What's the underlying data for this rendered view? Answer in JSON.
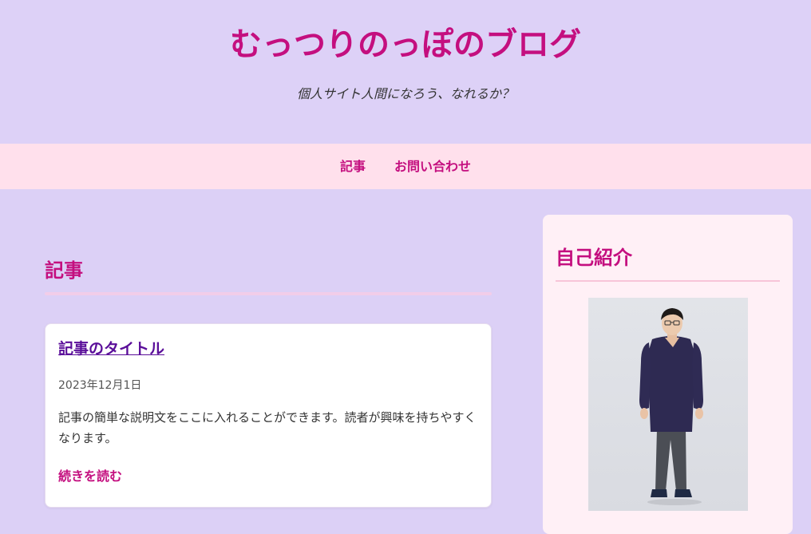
{
  "header": {
    "title": "むっつりのっぽのブログ",
    "tagline": "個人サイト人間になろう、なれるか？"
  },
  "nav": {
    "items": [
      {
        "label": "記事"
      },
      {
        "label": "お問い合わせ"
      }
    ]
  },
  "main": {
    "section_title": "記事",
    "posts": [
      {
        "title": "記事のタイトル",
        "date": "2023年12月1日",
        "excerpt": "記事の簡単な説明文をここに入れることができます。読者が興味を持ちやすくなります。",
        "read_more": "続きを読む"
      }
    ]
  },
  "sidebar": {
    "title": "自己紹介",
    "photo_icon": "profile-photo"
  },
  "colors": {
    "background": "#dcd0f6",
    "accent": "#c40f7f",
    "nav_background": "#ffe0ec",
    "link": "#5a0e99"
  }
}
